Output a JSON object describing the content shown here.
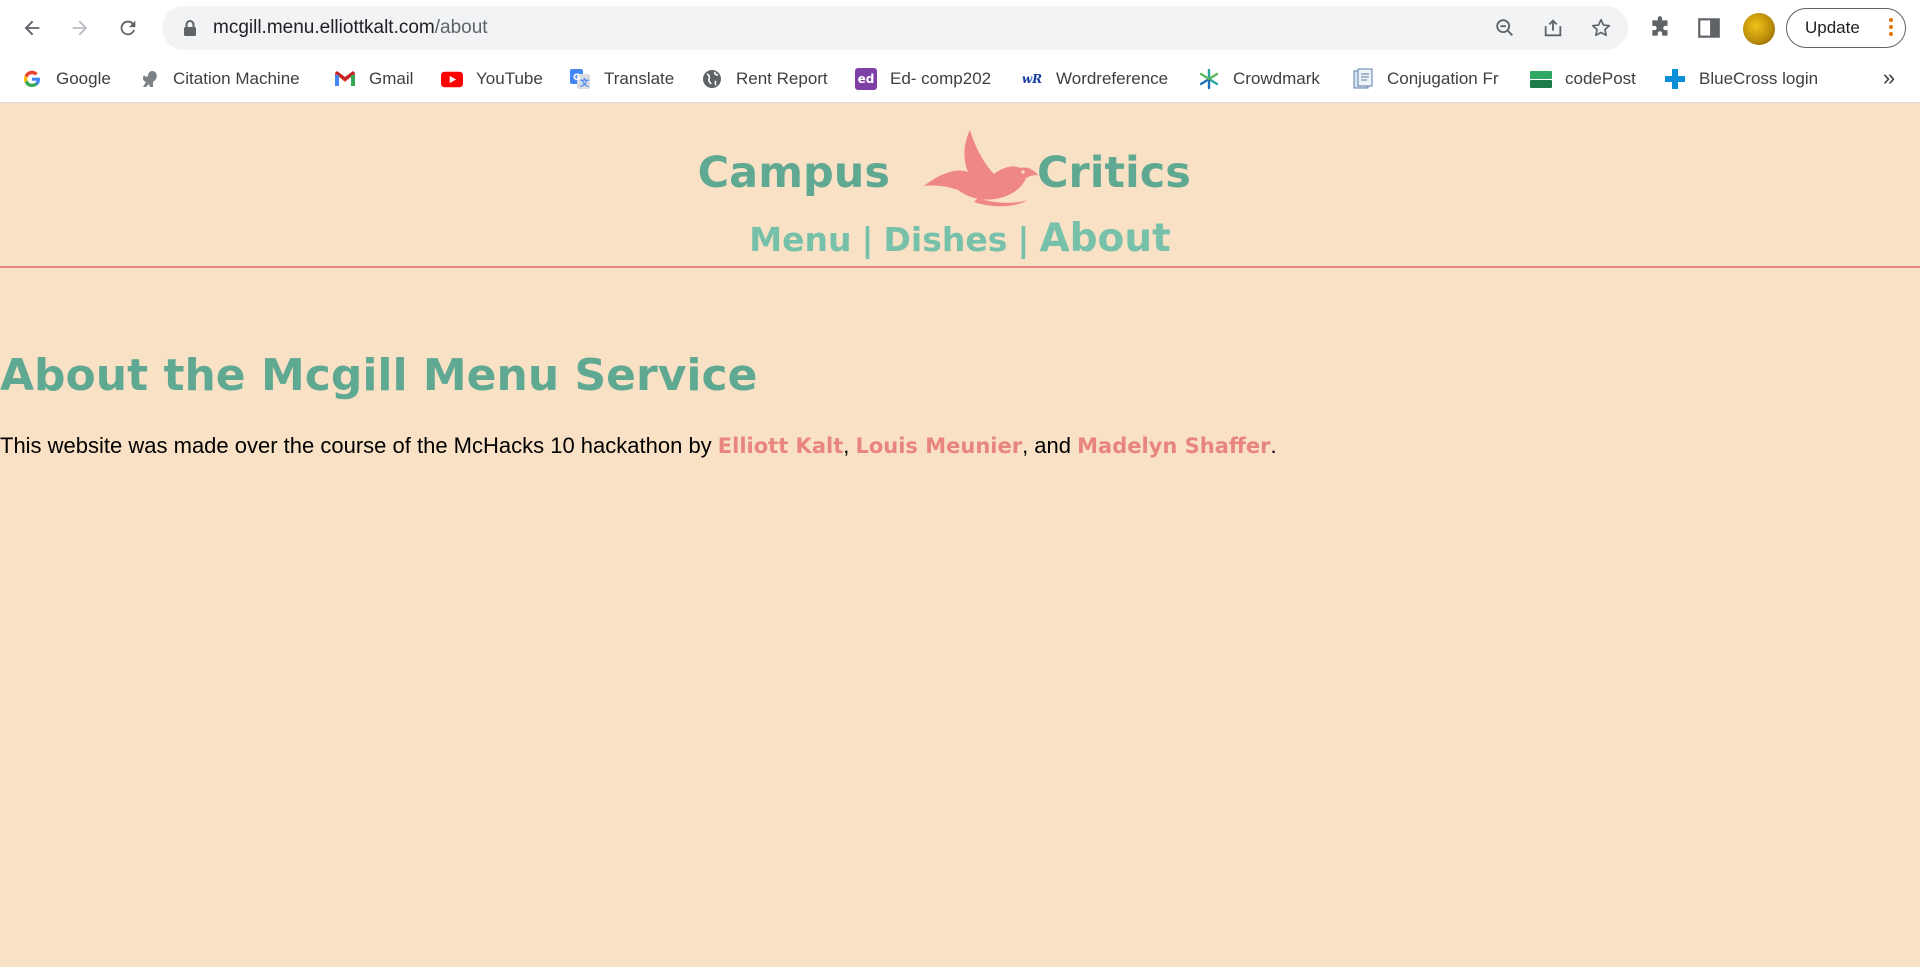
{
  "browser": {
    "url_host": "mcgill.menu.elliottkalt.com",
    "url_path": "/about",
    "update_label": "Update"
  },
  "bookmarks": [
    {
      "label": "Google",
      "icon": "google-icon"
    },
    {
      "label": "Citation Machine",
      "icon": "squirrel-icon"
    },
    {
      "label": "Gmail",
      "icon": "gmail-icon"
    },
    {
      "label": "YouTube",
      "icon": "youtube-icon"
    },
    {
      "label": "Translate",
      "icon": "translate-icon"
    },
    {
      "label": "Rent Report",
      "icon": "globe-icon"
    },
    {
      "label": "Ed- comp202",
      "icon": "ed-icon",
      "badge": "ed"
    },
    {
      "label": "Wordreference",
      "icon": "wordreference-icon",
      "badge": "wR"
    },
    {
      "label": "Crowdmark",
      "icon": "crowdmark-icon"
    },
    {
      "label": "Conjugation Fr",
      "icon": "conjugation-icon"
    },
    {
      "label": "codePost",
      "icon": "codepost-icon"
    },
    {
      "label": "BlueCross login",
      "icon": "bluecross-icon"
    }
  ],
  "bookmarks_more": "»",
  "site": {
    "logo_left": "Campus",
    "logo_right": "Critics",
    "nav": {
      "menu": "Menu",
      "dishes": "Dishes",
      "about": "About",
      "separator": "|"
    }
  },
  "about": {
    "title": "About the Mcgill Menu Service",
    "text_before": "This website was made over the course of the McHacks 10 hackathon by ",
    "author1": "Elliott Kalt",
    "sep1": ", ",
    "author2": "Louis Meunier",
    "sep2": ", and ",
    "author3": "Madelyn Shaffer",
    "text_end": "."
  },
  "colors": {
    "page_bg": "#f9e1c6",
    "brand_green": "#5fa892",
    "nav_green": "#77c0aa",
    "accent_coral": "#e8857f"
  }
}
